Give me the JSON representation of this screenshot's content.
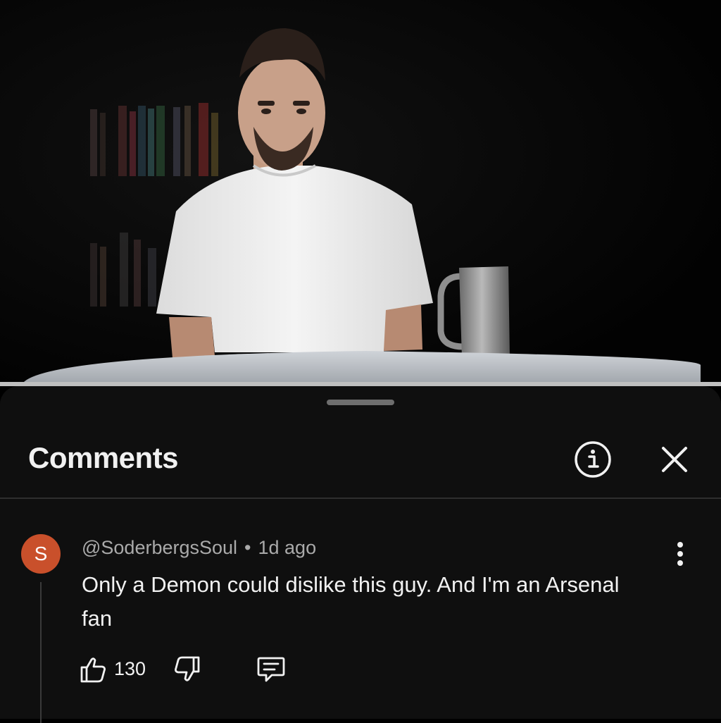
{
  "video": {
    "progress_fraction": 1.0
  },
  "sheet": {
    "title": "Comments",
    "info_icon": "info-icon",
    "close_icon": "close-icon"
  },
  "comment": {
    "avatar_letter": "S",
    "avatar_color": "#c9502b",
    "author": "@SoderbergsSoul",
    "separator": "•",
    "time": "1d ago",
    "text": "Only a Demon could dislike this guy. And I'm an Arsenal fan",
    "like_count": "130",
    "icons": [
      "thumbs-up-icon",
      "thumbs-down-icon",
      "reply-icon",
      "more-vertical-icon"
    ]
  }
}
